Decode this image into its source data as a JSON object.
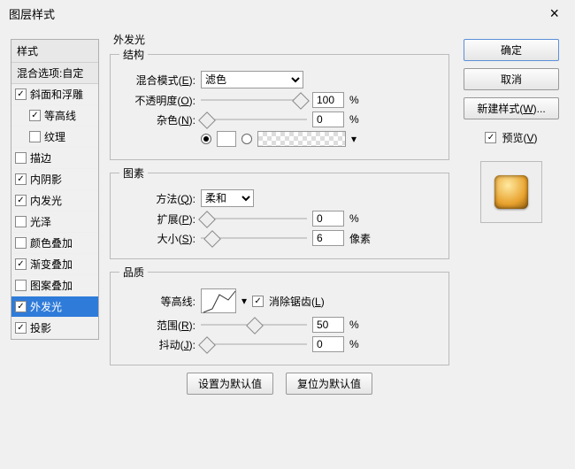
{
  "title": "图层样式",
  "styles_header": "样式",
  "blend_default": "混合选项:自定",
  "items": [
    "斜面和浮雕",
    "等高线",
    "纹理",
    "描边",
    "内阴影",
    "内发光",
    "光泽",
    "颜色叠加",
    "渐变叠加",
    "图案叠加",
    "外发光",
    "投影"
  ],
  "panel_title": "外发光",
  "g_struct": "结构",
  "lbl_blend": "混合模式(",
  "lbl_blend_h": "E",
  "lbl_blend2": "):",
  "val_blend": "滤色",
  "lbl_opacity": "不透明度(",
  "lbl_opacity_h": "O",
  "lbl_opacity2": "):",
  "val_opacity": "100",
  "pct": "%",
  "lbl_noise": "杂色(",
  "lbl_noise_h": "N",
  "lbl_noise2": "):",
  "val_noise": "0",
  "g_elem": "图素",
  "lbl_tech": "方法(",
  "lbl_tech_h": "Q",
  "lbl_tech2": "):",
  "val_tech": "柔和",
  "lbl_spread": "扩展(",
  "lbl_spread_h": "P",
  "lbl_spread2": "):",
  "val_spread": "0",
  "lbl_size": "大小(",
  "lbl_size_h": "S",
  "lbl_size2": "):",
  "val_size": "6",
  "px": "像素",
  "g_qual": "品质",
  "lbl_contour": "等高线:",
  "lbl_aa": "消除锯齿(",
  "lbl_aa_h": "L",
  "lbl_aa2": ")",
  "lbl_range": "范围(",
  "lbl_range_h": "R",
  "lbl_range2": "):",
  "val_range": "50",
  "lbl_jitter": "抖动(",
  "lbl_jitter_h": "J",
  "lbl_jitter2": "):",
  "val_jitter": "0",
  "btn_default": "设置为默认值",
  "btn_reset": "复位为默认值",
  "btn_ok": "确定",
  "btn_cancel": "取消",
  "btn_new": "新建样式(",
  "btn_new_h": "W",
  "btn_new2": ")...",
  "lbl_preview": "预览(",
  "lbl_preview_h": "V",
  "lbl_preview2": ")"
}
